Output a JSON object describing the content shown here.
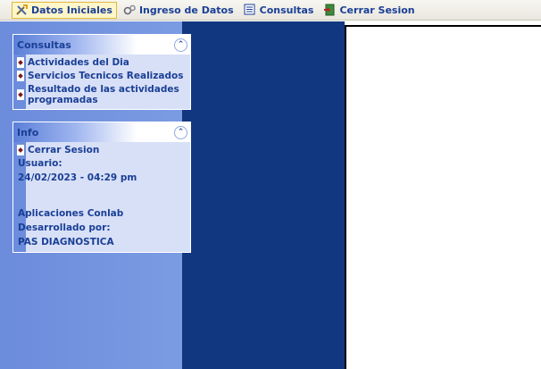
{
  "menu": {
    "items": [
      {
        "label": "Datos Iniciales",
        "icon": "tools-icon",
        "active": true
      },
      {
        "label": "Ingreso de Datos",
        "icon": "gears-icon",
        "active": false
      },
      {
        "label": "Consultas",
        "icon": "list-icon",
        "active": false
      },
      {
        "label": "Cerrar Sesion",
        "icon": "exit-icon",
        "active": false
      }
    ]
  },
  "consultas_panel": {
    "title": "Consultas",
    "links": [
      "Actividades del Dia",
      "Servicios Tecnicos Realizados",
      "Resultado de las actividades programadas"
    ]
  },
  "info_panel": {
    "title": "Info",
    "logout_link": "Cerrar Sesion",
    "user_label": "Usuario:",
    "datetime": "24/02/2023 - 04:29 pm",
    "app_name": "Aplicaciones Conlab",
    "developed_by_label": "Desarrollado por:",
    "developer": "PAS DIAGNOSTICA"
  },
  "colors": {
    "link": "#1a3f96",
    "left_pane": "#6c8cdc",
    "mid_pane": "#123781"
  }
}
